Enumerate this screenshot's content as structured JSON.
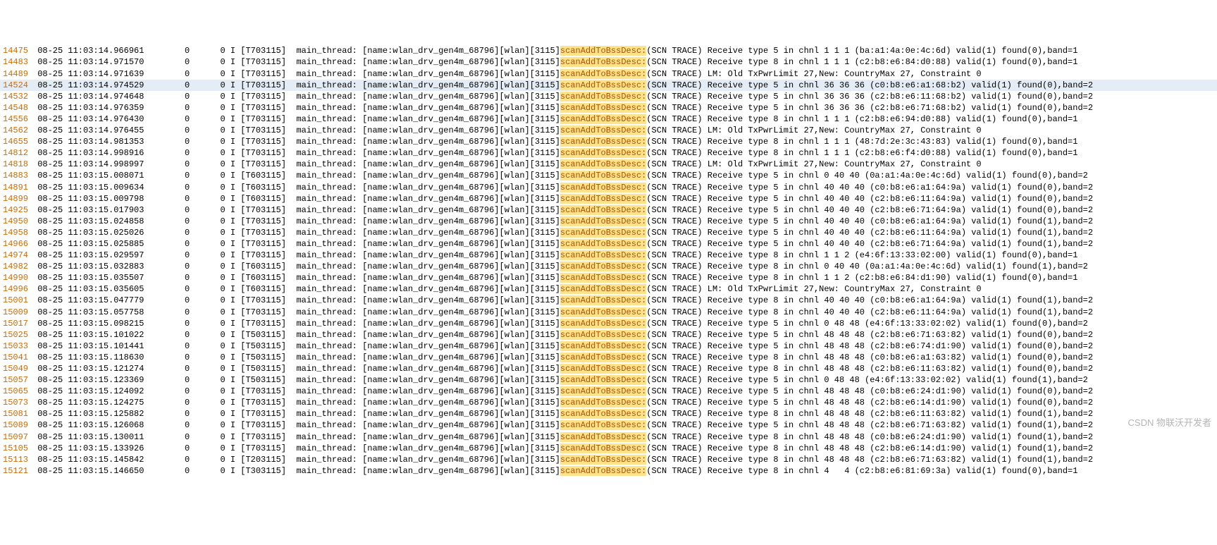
{
  "highlight_term": "scanAddToBssDesc:",
  "highlighted_line_index": 3,
  "watermark": "CSDN 物联沃开发者",
  "columns": {
    "c1_pad": 9,
    "c2_pad": 7
  },
  "rows": [
    {
      "lineno": "14475",
      "ts": "08-25 11:03:14.966961",
      "c1": "0",
      "c2": "0",
      "lvl": "I",
      "tid": "[T703115]",
      "thr": "main_thread:",
      "mid": "[name:wlan_drv_gen4m_68796][wlan][3115]",
      "hl": "scanAddToBssDesc:",
      "tail": "(SCN TRACE) Receive type 5 in chnl 1 1 1 (ba:a1:4a:0e:4c:6d) valid(1) found(0),band=1"
    },
    {
      "lineno": "14483",
      "ts": "08-25 11:03:14.971570",
      "c1": "0",
      "c2": "0",
      "lvl": "I",
      "tid": "[T703115]",
      "thr": "main_thread:",
      "mid": "[name:wlan_drv_gen4m_68796][wlan][3115]",
      "hl": "scanAddToBssDesc:",
      "tail": "(SCN TRACE) Receive type 8 in chnl 1 1 1 (c2:b8:e6:84:d0:88) valid(1) found(0),band=1"
    },
    {
      "lineno": "14489",
      "ts": "08-25 11:03:14.971639",
      "c1": "0",
      "c2": "0",
      "lvl": "I",
      "tid": "[T703115]",
      "thr": "main_thread:",
      "mid": "[name:wlan_drv_gen4m_68796][wlan][3115]",
      "hl": "scanAddToBssDesc:",
      "tail": "(SCN TRACE) LM: Old TxPwrLimit 27,New: CountryMax 27, Constraint 0"
    },
    {
      "lineno": "14524",
      "ts": "08-25 11:03:14.974529",
      "c1": "0",
      "c2": "0",
      "lvl": "I",
      "tid": "[T703115]",
      "thr": "main_thread:",
      "mid": "[name:wlan_drv_gen4m_68796][wlan][3115]",
      "hl": "scanAddToBssDesc:",
      "tail": "(SCN TRACE) Receive type 5 in chnl 36 36 36 (c0:b8:e6:a1:68:b2) valid(1) found(0),band=2"
    },
    {
      "lineno": "14532",
      "ts": "08-25 11:03:14.974648",
      "c1": "0",
      "c2": "0",
      "lvl": "I",
      "tid": "[T703115]",
      "thr": "main_thread:",
      "mid": "[name:wlan_drv_gen4m_68796][wlan][3115]",
      "hl": "scanAddToBssDesc:",
      "tail": "(SCN TRACE) Receive type 5 in chnl 36 36 36 (c2:b8:e6:11:68:b2) valid(1) found(0),band=2"
    },
    {
      "lineno": "14548",
      "ts": "08-25 11:03:14.976359",
      "c1": "0",
      "c2": "0",
      "lvl": "I",
      "tid": "[T703115]",
      "thr": "main_thread:",
      "mid": "[name:wlan_drv_gen4m_68796][wlan][3115]",
      "hl": "scanAddToBssDesc:",
      "tail": "(SCN TRACE) Receive type 5 in chnl 36 36 36 (c2:b8:e6:71:68:b2) valid(1) found(0),band=2"
    },
    {
      "lineno": "14556",
      "ts": "08-25 11:03:14.976430",
      "c1": "0",
      "c2": "0",
      "lvl": "I",
      "tid": "[T703115]",
      "thr": "main_thread:",
      "mid": "[name:wlan_drv_gen4m_68796][wlan][3115]",
      "hl": "scanAddToBssDesc:",
      "tail": "(SCN TRACE) Receive type 8 in chnl 1 1 1 (c2:b8:e6:94:d0:88) valid(1) found(0),band=1"
    },
    {
      "lineno": "14562",
      "ts": "08-25 11:03:14.976455",
      "c1": "0",
      "c2": "0",
      "lvl": "I",
      "tid": "[T703115]",
      "thr": "main_thread:",
      "mid": "[name:wlan_drv_gen4m_68796][wlan][3115]",
      "hl": "scanAddToBssDesc:",
      "tail": "(SCN TRACE) LM: Old TxPwrLimit 27,New: CountryMax 27, Constraint 0"
    },
    {
      "lineno": "14655",
      "ts": "08-25 11:03:14.981353",
      "c1": "0",
      "c2": "0",
      "lvl": "I",
      "tid": "[T703115]",
      "thr": "main_thread:",
      "mid": "[name:wlan_drv_gen4m_68796][wlan][3115]",
      "hl": "scanAddToBssDesc:",
      "tail": "(SCN TRACE) Receive type 8 in chnl 1 1 1 (48:7d:2e:3c:43:83) valid(1) found(0),band=1"
    },
    {
      "lineno": "14812",
      "ts": "08-25 11:03:14.998916",
      "c1": "0",
      "c2": "0",
      "lvl": "I",
      "tid": "[T703115]",
      "thr": "main_thread:",
      "mid": "[name:wlan_drv_gen4m_68796][wlan][3115]",
      "hl": "scanAddToBssDesc:",
      "tail": "(SCN TRACE) Receive type 8 in chnl 1 1 1 (c2:b8:e6:f4:d0:88) valid(1) found(0),band=1"
    },
    {
      "lineno": "14818",
      "ts": "08-25 11:03:14.998997",
      "c1": "0",
      "c2": "0",
      "lvl": "I",
      "tid": "[T703115]",
      "thr": "main_thread:",
      "mid": "[name:wlan_drv_gen4m_68796][wlan][3115]",
      "hl": "scanAddToBssDesc:",
      "tail": "(SCN TRACE) LM: Old TxPwrLimit 27,New: CountryMax 27, Constraint 0"
    },
    {
      "lineno": "14883",
      "ts": "08-25 11:03:15.008071",
      "c1": "0",
      "c2": "0",
      "lvl": "I",
      "tid": "[T603115]",
      "thr": "main_thread:",
      "mid": "[name:wlan_drv_gen4m_68796][wlan][3115]",
      "hl": "scanAddToBssDesc:",
      "tail": "(SCN TRACE) Receive type 5 in chnl 0 40 40 (0a:a1:4a:0e:4c:6d) valid(1) found(0),band=2"
    },
    {
      "lineno": "14891",
      "ts": "08-25 11:03:15.009634",
      "c1": "0",
      "c2": "0",
      "lvl": "I",
      "tid": "[T603115]",
      "thr": "main_thread:",
      "mid": "[name:wlan_drv_gen4m_68796][wlan][3115]",
      "hl": "scanAddToBssDesc:",
      "tail": "(SCN TRACE) Receive type 5 in chnl 40 40 40 (c0:b8:e6:a1:64:9a) valid(1) found(0),band=2"
    },
    {
      "lineno": "14899",
      "ts": "08-25 11:03:15.009798",
      "c1": "0",
      "c2": "0",
      "lvl": "I",
      "tid": "[T603115]",
      "thr": "main_thread:",
      "mid": "[name:wlan_drv_gen4m_68796][wlan][3115]",
      "hl": "scanAddToBssDesc:",
      "tail": "(SCN TRACE) Receive type 5 in chnl 40 40 40 (c2:b8:e6:11:64:9a) valid(1) found(0),band=2"
    },
    {
      "lineno": "14925",
      "ts": "08-25 11:03:15.017903",
      "c1": "0",
      "c2": "0",
      "lvl": "I",
      "tid": "[T703115]",
      "thr": "main_thread:",
      "mid": "[name:wlan_drv_gen4m_68796][wlan][3115]",
      "hl": "scanAddToBssDesc:",
      "tail": "(SCN TRACE) Receive type 5 in chnl 40 40 40 (c2:b8:e6:71:64:9a) valid(1) found(0),band=2"
    },
    {
      "lineno": "14950",
      "ts": "08-25 11:03:15.024858",
      "c1": "0",
      "c2": "0",
      "lvl": "I",
      "tid": "[T703115]",
      "thr": "main_thread:",
      "mid": "[name:wlan_drv_gen4m_68796][wlan][3115]",
      "hl": "scanAddToBssDesc:",
      "tail": "(SCN TRACE) Receive type 5 in chnl 40 40 40 (c0:b8:e6:a1:64:9a) valid(1) found(1),band=2"
    },
    {
      "lineno": "14958",
      "ts": "08-25 11:03:15.025026",
      "c1": "0",
      "c2": "0",
      "lvl": "I",
      "tid": "[T703115]",
      "thr": "main_thread:",
      "mid": "[name:wlan_drv_gen4m_68796][wlan][3115]",
      "hl": "scanAddToBssDesc:",
      "tail": "(SCN TRACE) Receive type 5 in chnl 40 40 40 (c2:b8:e6:11:64:9a) valid(1) found(1),band=2"
    },
    {
      "lineno": "14966",
      "ts": "08-25 11:03:15.025885",
      "c1": "0",
      "c2": "0",
      "lvl": "I",
      "tid": "[T703115]",
      "thr": "main_thread:",
      "mid": "[name:wlan_drv_gen4m_68796][wlan][3115]",
      "hl": "scanAddToBssDesc:",
      "tail": "(SCN TRACE) Receive type 5 in chnl 40 40 40 (c2:b8:e6:71:64:9a) valid(1) found(1),band=2"
    },
    {
      "lineno": "14974",
      "ts": "08-25 11:03:15.029597",
      "c1": "0",
      "c2": "0",
      "lvl": "I",
      "tid": "[T703115]",
      "thr": "main_thread:",
      "mid": "[name:wlan_drv_gen4m_68796][wlan][3115]",
      "hl": "scanAddToBssDesc:",
      "tail": "(SCN TRACE) Receive type 8 in chnl 1 1 2 (e4:6f:13:33:02:00) valid(1) found(0),band=1"
    },
    {
      "lineno": "14982",
      "ts": "08-25 11:03:15.032883",
      "c1": "0",
      "c2": "0",
      "lvl": "I",
      "tid": "[T603115]",
      "thr": "main_thread:",
      "mid": "[name:wlan_drv_gen4m_68796][wlan][3115]",
      "hl": "scanAddToBssDesc:",
      "tail": "(SCN TRACE) Receive type 8 in chnl 0 40 40 (0a:a1:4a:0e:4c:6d) valid(1) found(1),band=2"
    },
    {
      "lineno": "14990",
      "ts": "08-25 11:03:15.035507",
      "c1": "0",
      "c2": "0",
      "lvl": "I",
      "tid": "[T603115]",
      "thr": "main_thread:",
      "mid": "[name:wlan_drv_gen4m_68796][wlan][3115]",
      "hl": "scanAddToBssDesc:",
      "tail": "(SCN TRACE) Receive type 8 in chnl 1 1 2 (c2:b8:e6:84:d1:90) valid(1) found(0),band=1"
    },
    {
      "lineno": "14996",
      "ts": "08-25 11:03:15.035605",
      "c1": "0",
      "c2": "0",
      "lvl": "I",
      "tid": "[T603115]",
      "thr": "main_thread:",
      "mid": "[name:wlan_drv_gen4m_68796][wlan][3115]",
      "hl": "scanAddToBssDesc:",
      "tail": "(SCN TRACE) LM: Old TxPwrLimit 27,New: CountryMax 27, Constraint 0"
    },
    {
      "lineno": "15001",
      "ts": "08-25 11:03:15.047779",
      "c1": "0",
      "c2": "0",
      "lvl": "I",
      "tid": "[T703115]",
      "thr": "main_thread:",
      "mid": "[name:wlan_drv_gen4m_68796][wlan][3115]",
      "hl": "scanAddToBssDesc:",
      "tail": "(SCN TRACE) Receive type 8 in chnl 40 40 40 (c0:b8:e6:a1:64:9a) valid(1) found(1),band=2"
    },
    {
      "lineno": "15009",
      "ts": "08-25 11:03:15.057758",
      "c1": "0",
      "c2": "0",
      "lvl": "I",
      "tid": "[T703115]",
      "thr": "main_thread:",
      "mid": "[name:wlan_drv_gen4m_68796][wlan][3115]",
      "hl": "scanAddToBssDesc:",
      "tail": "(SCN TRACE) Receive type 8 in chnl 40 40 40 (c2:b8:e6:11:64:9a) valid(1) found(1),band=2"
    },
    {
      "lineno": "15017",
      "ts": "08-25 11:03:15.098215",
      "c1": "0",
      "c2": "0",
      "lvl": "I",
      "tid": "[T703115]",
      "thr": "main_thread:",
      "mid": "[name:wlan_drv_gen4m_68796][wlan][3115]",
      "hl": "scanAddToBssDesc:",
      "tail": "(SCN TRACE) Receive type 5 in chnl 0 48 48 (e4:6f:13:33:02:02) valid(1) found(0),band=2"
    },
    {
      "lineno": "15025",
      "ts": "08-25 11:03:15.101022",
      "c1": "0",
      "c2": "0",
      "lvl": "I",
      "tid": "[T503115]",
      "thr": "main_thread:",
      "mid": "[name:wlan_drv_gen4m_68796][wlan][3115]",
      "hl": "scanAddToBssDesc:",
      "tail": "(SCN TRACE) Receive type 5 in chnl 48 48 48 (c2:b8:e6:71:63:82) valid(1) found(0),band=2"
    },
    {
      "lineno": "15033",
      "ts": "08-25 11:03:15.101441",
      "c1": "0",
      "c2": "0",
      "lvl": "I",
      "tid": "[T503115]",
      "thr": "main_thread:",
      "mid": "[name:wlan_drv_gen4m_68796][wlan][3115]",
      "hl": "scanAddToBssDesc:",
      "tail": "(SCN TRACE) Receive type 5 in chnl 48 48 48 (c2:b8:e6:74:d1:90) valid(1) found(0),band=2"
    },
    {
      "lineno": "15041",
      "ts": "08-25 11:03:15.118630",
      "c1": "0",
      "c2": "0",
      "lvl": "I",
      "tid": "[T503115]",
      "thr": "main_thread:",
      "mid": "[name:wlan_drv_gen4m_68796][wlan][3115]",
      "hl": "scanAddToBssDesc:",
      "tail": "(SCN TRACE) Receive type 8 in chnl 48 48 48 (c0:b8:e6:a1:63:82) valid(1) found(0),band=2"
    },
    {
      "lineno": "15049",
      "ts": "08-25 11:03:15.121274",
      "c1": "0",
      "c2": "0",
      "lvl": "I",
      "tid": "[T503115]",
      "thr": "main_thread:",
      "mid": "[name:wlan_drv_gen4m_68796][wlan][3115]",
      "hl": "scanAddToBssDesc:",
      "tail": "(SCN TRACE) Receive type 8 in chnl 48 48 48 (c2:b8:e6:11:63:82) valid(1) found(0),band=2"
    },
    {
      "lineno": "15057",
      "ts": "08-25 11:03:15.123369",
      "c1": "0",
      "c2": "0",
      "lvl": "I",
      "tid": "[T503115]",
      "thr": "main_thread:",
      "mid": "[name:wlan_drv_gen4m_68796][wlan][3115]",
      "hl": "scanAddToBssDesc:",
      "tail": "(SCN TRACE) Receive type 5 in chnl 0 48 48 (e4:6f:13:33:02:02) valid(1) found(1),band=2"
    },
    {
      "lineno": "15065",
      "ts": "08-25 11:03:15.124092",
      "c1": "0",
      "c2": "0",
      "lvl": "I",
      "tid": "[T703115]",
      "thr": "main_thread:",
      "mid": "[name:wlan_drv_gen4m_68796][wlan][3115]",
      "hl": "scanAddToBssDesc:",
      "tail": "(SCN TRACE) Receive type 5 in chnl 48 48 48 (c0:b8:e6:24:d1:90) valid(1) found(0),band=2"
    },
    {
      "lineno": "15073",
      "ts": "08-25 11:03:15.124275",
      "c1": "0",
      "c2": "0",
      "lvl": "I",
      "tid": "[T703115]",
      "thr": "main_thread:",
      "mid": "[name:wlan_drv_gen4m_68796][wlan][3115]",
      "hl": "scanAddToBssDesc:",
      "tail": "(SCN TRACE) Receive type 5 in chnl 48 48 48 (c2:b8:e6:14:d1:90) valid(1) found(0),band=2"
    },
    {
      "lineno": "15081",
      "ts": "08-25 11:03:15.125882",
      "c1": "0",
      "c2": "0",
      "lvl": "I",
      "tid": "[T703115]",
      "thr": "main_thread:",
      "mid": "[name:wlan_drv_gen4m_68796][wlan][3115]",
      "hl": "scanAddToBssDesc:",
      "tail": "(SCN TRACE) Receive type 8 in chnl 48 48 48 (c2:b8:e6:11:63:82) valid(1) found(1),band=2"
    },
    {
      "lineno": "15089",
      "ts": "08-25 11:03:15.126068",
      "c1": "0",
      "c2": "0",
      "lvl": "I",
      "tid": "[T703115]",
      "thr": "main_thread:",
      "mid": "[name:wlan_drv_gen4m_68796][wlan][3115]",
      "hl": "scanAddToBssDesc:",
      "tail": "(SCN TRACE) Receive type 5 in chnl 48 48 48 (c2:b8:e6:71:63:82) valid(1) found(1),band=2"
    },
    {
      "lineno": "15097",
      "ts": "08-25 11:03:15.130011",
      "c1": "0",
      "c2": "0",
      "lvl": "I",
      "tid": "[T703115]",
      "thr": "main_thread:",
      "mid": "[name:wlan_drv_gen4m_68796][wlan][3115]",
      "hl": "scanAddToBssDesc:",
      "tail": "(SCN TRACE) Receive type 8 in chnl 48 48 48 (c0:b8:e6:24:d1:90) valid(1) found(1),band=2"
    },
    {
      "lineno": "15105",
      "ts": "08-25 11:03:15.133926",
      "c1": "0",
      "c2": "0",
      "lvl": "I",
      "tid": "[T703115]",
      "thr": "main_thread:",
      "mid": "[name:wlan_drv_gen4m_68796][wlan][3115]",
      "hl": "scanAddToBssDesc:",
      "tail": "(SCN TRACE) Receive type 8 in chnl 48 48 48 (c2:b8:e6:14:d1:90) valid(1) found(1),band=2"
    },
    {
      "lineno": "15113",
      "ts": "08-25 11:03:15.145842",
      "c1": "0",
      "c2": "0",
      "lvl": "I",
      "tid": "[T203115]",
      "thr": "main_thread:",
      "mid": "[name:wlan_drv_gen4m_68796][wlan][3115]",
      "hl": "scanAddToBssDesc:",
      "tail": "(SCN TRACE) Receive type 8 in chnl 48 48 48 (c2:b8:e6:71:63:82) valid(1) found(1),band=2"
    },
    {
      "lineno": "15121",
      "ts": "08-25 11:03:15.146650",
      "c1": "0",
      "c2": "0",
      "lvl": "I",
      "tid": "[T303115]",
      "thr": "main_thread:",
      "mid": "[name:wlan_drv_gen4m_68796][wlan][3115]",
      "hl": "scanAddToBssDesc:",
      "tail": "(SCN TRACE) Receive type 8 in chnl 4   4 (c2:b8:e6:81:69:3a) valid(1) found(0),band=1"
    }
  ]
}
